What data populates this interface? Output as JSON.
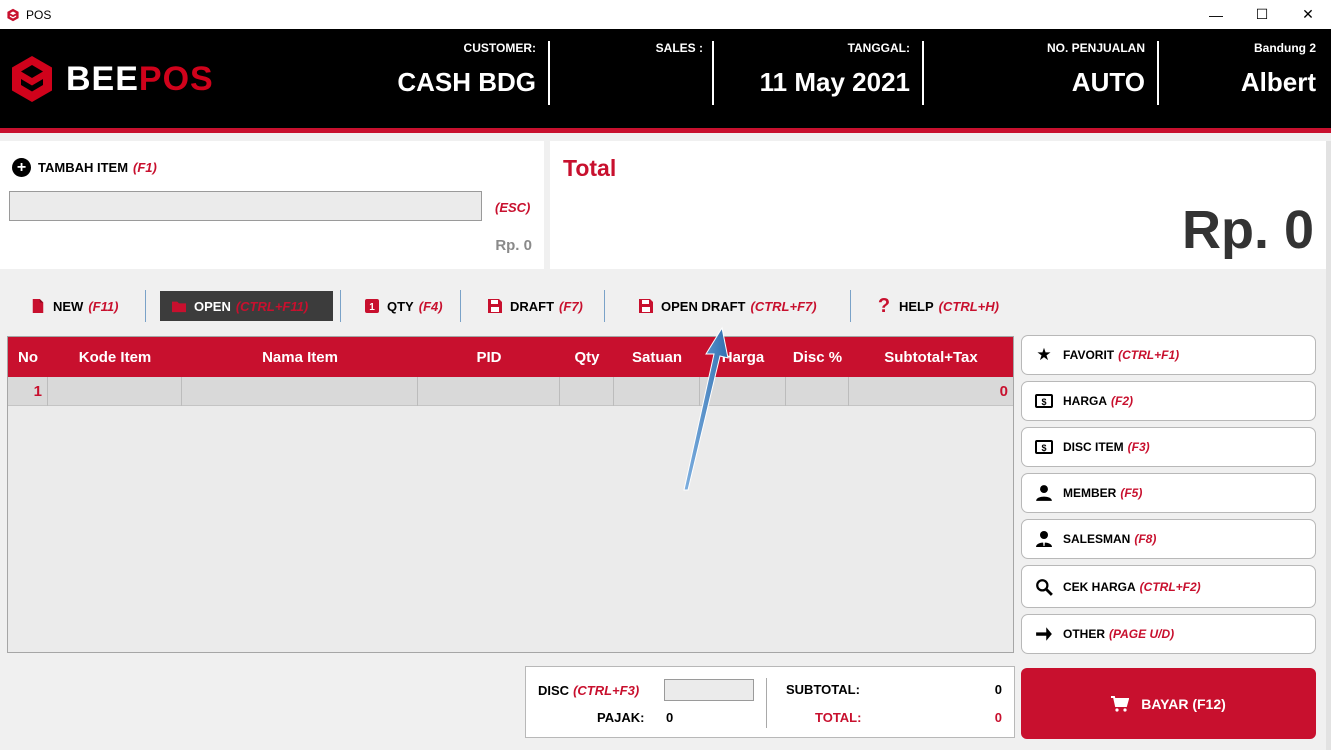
{
  "window": {
    "title": "POS",
    "minimize": "—",
    "maximize": "☐",
    "close": "✕"
  },
  "header": {
    "logo": {
      "bee": "BEE",
      "pos": "POS"
    },
    "customer": {
      "label": "CUSTOMER:",
      "value": "CASH BDG"
    },
    "sales": {
      "label": "SALES :",
      "value": ""
    },
    "tanggal": {
      "label": "TANGGAL:",
      "value": "11 May 2021"
    },
    "no_penjualan": {
      "label": "NO. PENJUALAN",
      "value": "AUTO"
    },
    "branch": {
      "label": "Bandung 2",
      "value": "Albert"
    }
  },
  "add_item": {
    "label": "TAMBAH ITEM",
    "key": "(F1)",
    "input_value": "",
    "esc": "(ESC)",
    "price": "Rp. 0"
  },
  "total": {
    "title": "Total",
    "value": "Rp. 0"
  },
  "toolbar": {
    "new": {
      "label": "NEW",
      "key": "(F11)"
    },
    "open": {
      "label": "OPEN",
      "key": "(CTRL+F11)"
    },
    "qty": {
      "label": "QTY",
      "key": "(F4)"
    },
    "draft": {
      "label": "DRAFT",
      "key": "(F7)"
    },
    "open_draft": {
      "label": "OPEN DRAFT",
      "key": "(CTRL+F7)"
    },
    "help": {
      "label": "HELP",
      "key": "(CTRL+H)"
    }
  },
  "table": {
    "columns": [
      "No",
      "Kode Item",
      "Nama Item",
      "PID",
      "Qty",
      "Satuan",
      "Harga",
      "Disc %",
      "Subtotal+Tax"
    ],
    "rows": [
      {
        "no": "1",
        "kode": "",
        "nama": "",
        "pid": "",
        "qty": "",
        "satuan": "",
        "harga": "",
        "disc": "",
        "subtotal": "0"
      }
    ]
  },
  "side_buttons": {
    "favorit": {
      "label": "FAVORIT",
      "key": "(CTRL+F1)"
    },
    "harga": {
      "label": "HARGA",
      "key": "(F2)"
    },
    "disc_item": {
      "label": "DISC ITEM",
      "key": "(F3)"
    },
    "member": {
      "label": "MEMBER",
      "key": "(F5)"
    },
    "salesman": {
      "label": "SALESMAN",
      "key": "(F8)"
    },
    "cek_harga": {
      "label": "CEK HARGA",
      "key": "(CTRL+F2)"
    },
    "other": {
      "label": "OTHER",
      "key": "(PAGE U/D)"
    }
  },
  "summary": {
    "disc_label": "DISC",
    "disc_key": "(CTRL+F3)",
    "disc_value": "",
    "pajak_label": "PAJAK:",
    "pajak_value": "0",
    "subtotal_label": "SUBTOTAL:",
    "subtotal_value": "0",
    "total_label": "TOTAL:",
    "total_value": "0"
  },
  "pay": {
    "label": "BAYAR (F12)"
  },
  "colors": {
    "brand_red": "#c8102e",
    "header_bg": "#000000",
    "annotation_arrow": "#4a86c5"
  }
}
